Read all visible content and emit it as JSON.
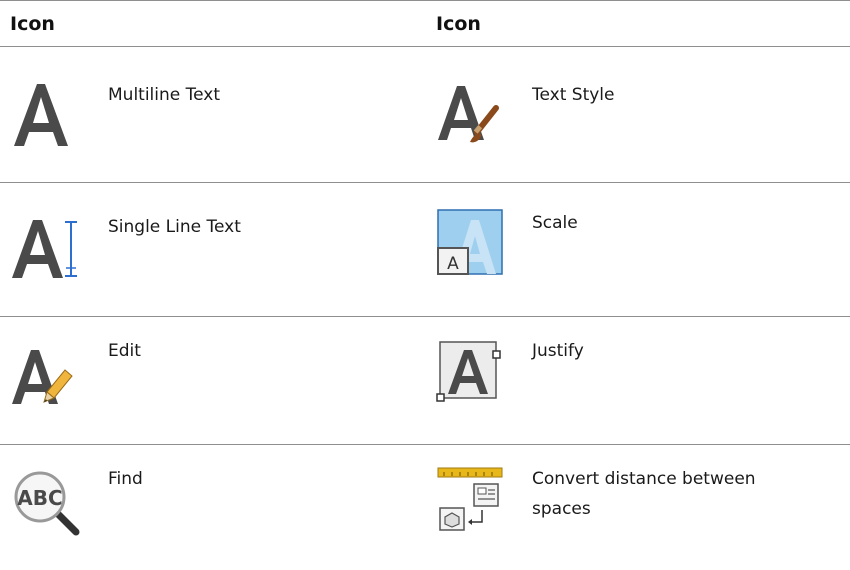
{
  "table": {
    "headers": [
      "Icon",
      "Icon"
    ],
    "rows": [
      {
        "left": {
          "icon": "multiline-text-icon",
          "label": "Multiline Text"
        },
        "right": {
          "icon": "text-style-icon",
          "label": "Text Style"
        }
      },
      {
        "left": {
          "icon": "single-line-text-icon",
          "label": "Single Line Text"
        },
        "right": {
          "icon": "scale-icon",
          "label": "Scale"
        }
      },
      {
        "left": {
          "icon": "edit-text-icon",
          "label": "Edit"
        },
        "right": {
          "icon": "justify-icon",
          "label": "Justify"
        }
      },
      {
        "left": {
          "icon": "find-abc-magnifier-icon",
          "label": "Find"
        },
        "right": {
          "icon": "convert-distance-icon",
          "label": "Convert distance between spaces"
        }
      }
    ]
  },
  "colors": {
    "rule": "#8f8f8f",
    "letter": "#4a4a4a",
    "accent_blue": "#2c6fd1",
    "brush_brown": "#8a4a1c",
    "pencil_yellow": "#f0b53c",
    "ruler_yellow": "#e8b81a",
    "scale_blue": "#9fcfee"
  }
}
